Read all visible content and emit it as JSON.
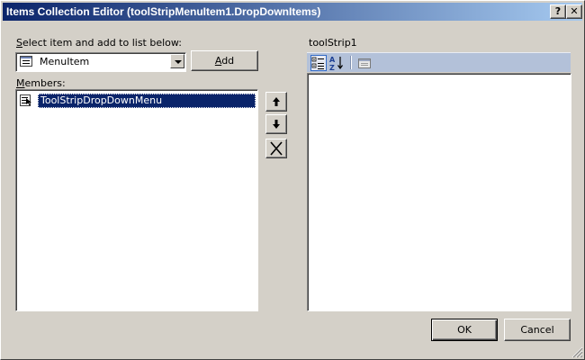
{
  "window": {
    "title": "Items Collection Editor (toolStripMenuItem1.DropDownItems)",
    "help_glyph": "?",
    "close_glyph": "✕"
  },
  "selector": {
    "label": "Select item and add to list below:",
    "label_mnemonic": "S",
    "label_rest": "elect item and add to list below:",
    "selected_type": "MenuItem",
    "add_label_mnemonic": "A",
    "add_label_rest": "dd"
  },
  "members": {
    "label_mnemonic": "M",
    "label_rest": "embers:",
    "items": [
      {
        "label": "ToolStripDropDownMenu",
        "selected": true
      }
    ]
  },
  "properties": {
    "object_name": "toolStrip1"
  },
  "footer": {
    "ok_label": "OK",
    "cancel_label": "Cancel"
  },
  "colors": {
    "title_gradient_start": "#0a246a",
    "title_gradient_end": "#a6caf0",
    "selection": "#0a246a",
    "dialog_face": "#d4d0c8",
    "propgrid_toolbar": "#b3c1d9"
  }
}
